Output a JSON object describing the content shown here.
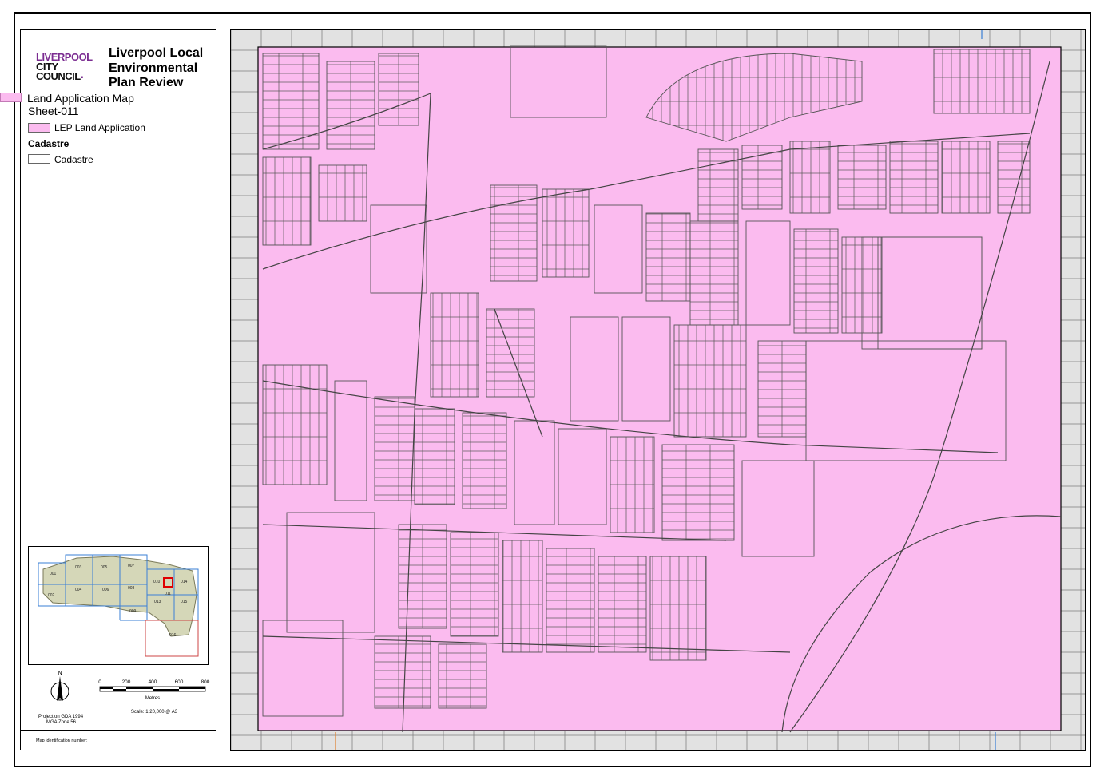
{
  "header": {
    "logo_line1": "LIVERPOOL",
    "logo_line2": "CITY",
    "logo_line3": "COUNCIL",
    "title": "Liverpool Local Environmental Plan Review",
    "map_name": "Land Application Map",
    "sheet": "Sheet-011"
  },
  "legend": {
    "lep_label": "LEP Land Application",
    "lep_color": "#fbbbef",
    "cadastre_heading": "Cadastre",
    "cadastre_label": "Cadastre"
  },
  "keymap": {
    "sheets": [
      "001",
      "002",
      "003",
      "004",
      "005",
      "006",
      "007",
      "008",
      "009",
      "010",
      "011",
      "012",
      "013",
      "014",
      "015",
      "016"
    ],
    "highlight_sheet": "011"
  },
  "scale": {
    "north_label": "N",
    "ticks": [
      "0",
      "200",
      "400",
      "600",
      "800"
    ],
    "units": "Metres",
    "scale_text": "Scale: 1:20,000 @ A3",
    "projection_line1": "Projection GDA 1994",
    "projection_line2": "MGA Zone 56"
  },
  "footer": {
    "map_id_label": "Map identification number:"
  },
  "map": {
    "background_color": "#e2e2e2",
    "application_color": "#fbbbef",
    "line_color": "#555555"
  }
}
